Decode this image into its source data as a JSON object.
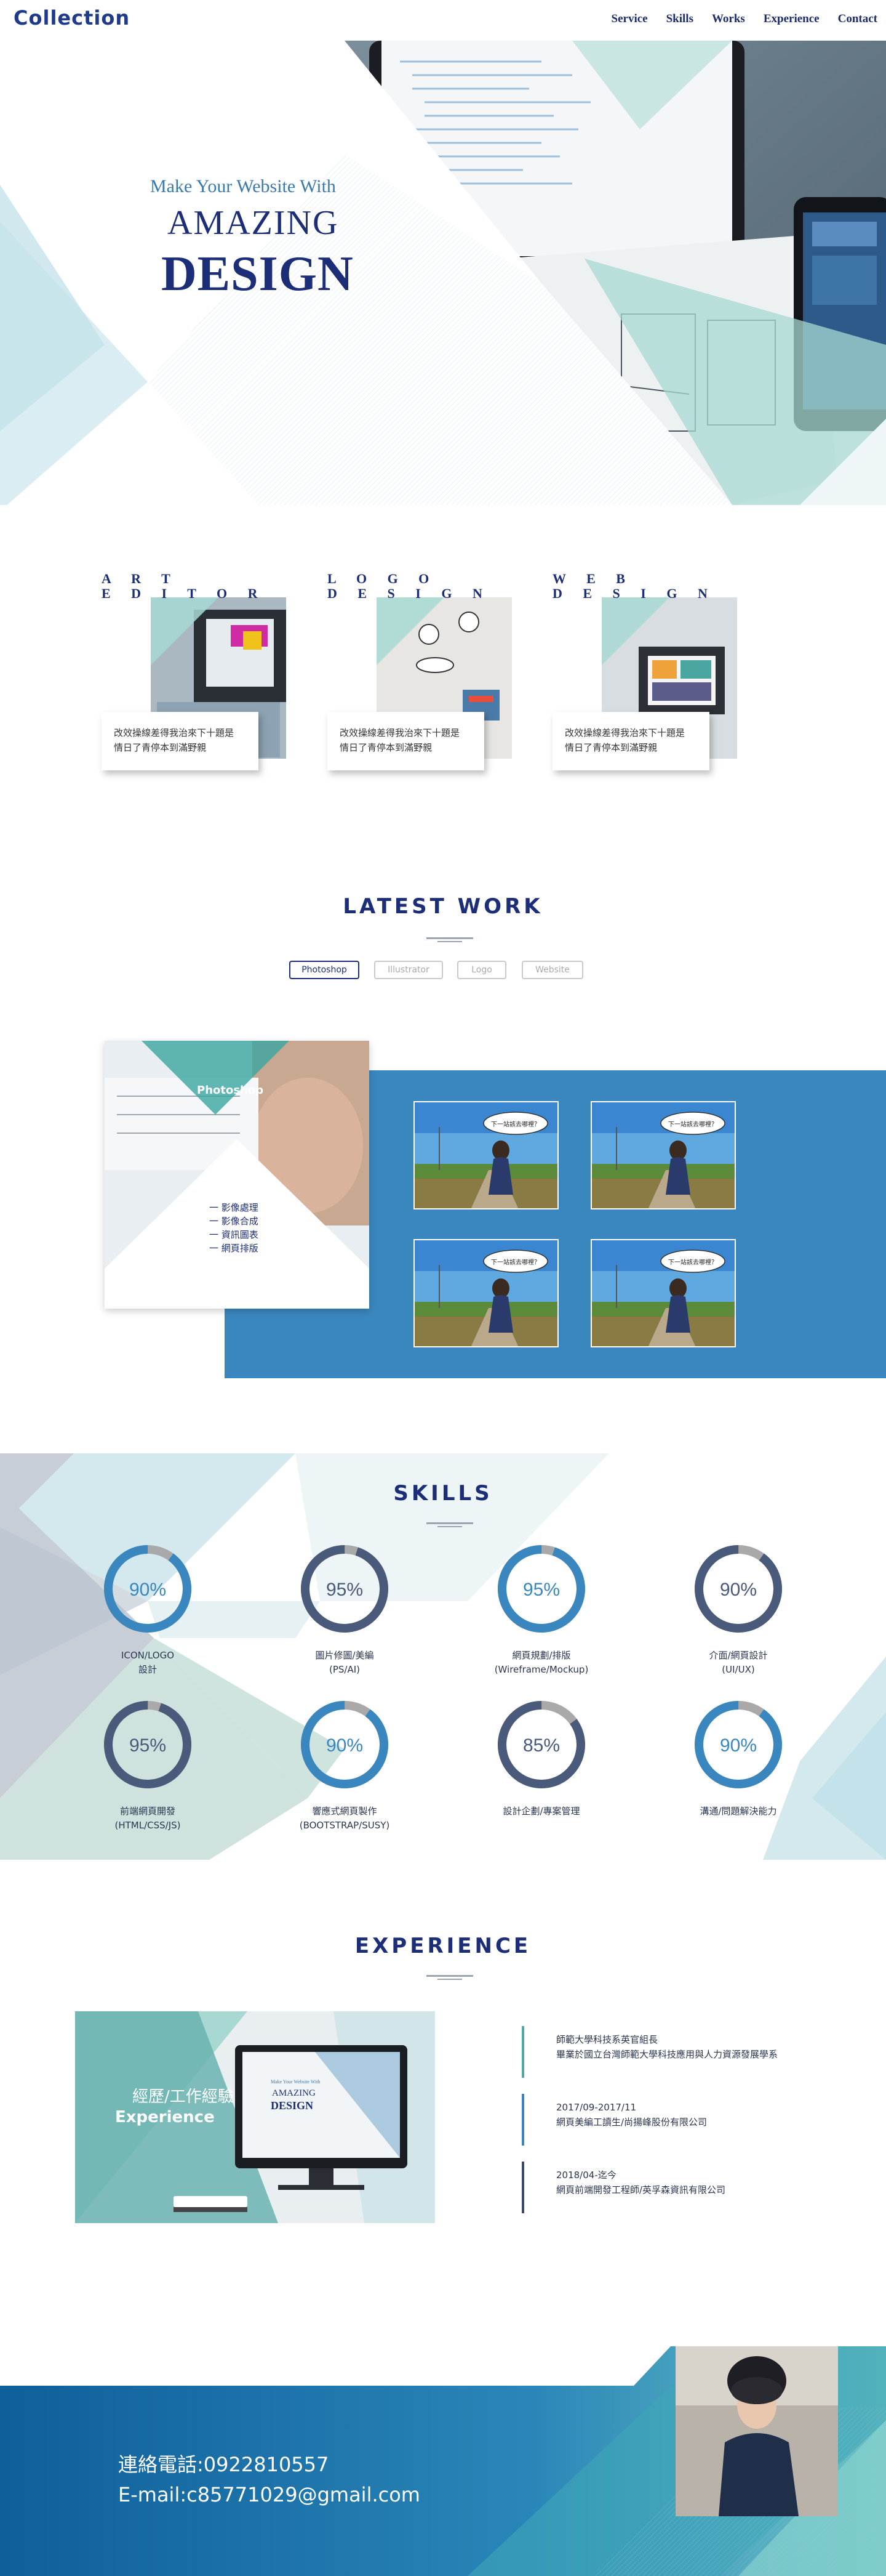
{
  "brand": {
    "logo": "Collection"
  },
  "nav": {
    "items": [
      "Service",
      "Skills",
      "Works",
      "Experience",
      "Contact"
    ]
  },
  "hero": {
    "subtitle": "Make Your Website With",
    "title1": "AMAZING",
    "title2": "DESIGN"
  },
  "services": [
    {
      "title": "A R T\nE D I T O R",
      "text1": "改效操線差得我治來下十題是",
      "text2": "情日了青停本到滿野親"
    },
    {
      "title": "L O G O\nD E S I G N",
      "text1": "改效操線差得我治來下十題是",
      "text2": "情日了青停本到滿野親"
    },
    {
      "title": "W E B\nD E S I G N",
      "text1": "改效操線差得我治來下十題是",
      "text2": "情日了青停本到滿野親"
    }
  ],
  "latest_work": {
    "title": "LATEST WORK",
    "filters": [
      "Photoshop",
      "Illustrator",
      "Logo",
      "Website"
    ],
    "active_filter": "Photoshop",
    "panel_label": "Photoshop",
    "panel_list": [
      "一 影像處理",
      "一 影像合成",
      "一 資訊圖表",
      "一 網頁排版"
    ],
    "thumb_bubble": "下一站該去哪裡？"
  },
  "skills": {
    "title": "SKILLS",
    "items": [
      {
        "pct": 90,
        "value": "90%",
        "label": "ICON/LOGO\n設計"
      },
      {
        "pct": 95,
        "value": "95%",
        "label": "圖片修圖/美編\n(PS/AI)"
      },
      {
        "pct": 95,
        "value": "95%",
        "label": "網頁規劃/排版\n(Wireframe/Mockup)"
      },
      {
        "pct": 90,
        "value": "90%",
        "label": "介面/網頁設計\n(UI/UX)"
      },
      {
        "pct": 95,
        "value": "95%",
        "label": "前端網頁開發\n(HTML/CSS/JS)"
      },
      {
        "pct": 90,
        "value": "90%",
        "label": "響應式網頁製作\n(BOOTSTRAP/SUSY)"
      },
      {
        "pct": 85,
        "value": "85%",
        "label": "設計企劃/專案管理"
      },
      {
        "pct": 90,
        "value": "90%",
        "label": "溝通/問題解決能力"
      }
    ]
  },
  "experience": {
    "title": "EXPERIENCE",
    "image_title_cn": "經歷/工作經驗",
    "image_title_en": "Experience",
    "monitor_sub": "Make Your Website With",
    "monitor_t1": "AMAZING",
    "monitor_t2": "DESIGN",
    "items": [
      {
        "line1": "師範大學科技系英官組長",
        "line2": "畢業於國立台灣師範大學科技應用與人力資源發展學系",
        "color": "#4fa9a4"
      },
      {
        "line1": "2017/09-2017/11",
        "line2": "網頁美編工讀生/尚揚峰股份有限公司",
        "color": "#3a87bf"
      },
      {
        "line1": "2018/04-迄今",
        "line2": "網頁前端開發工程師/英孚森資訊有限公司",
        "color": "#3a4a6a"
      }
    ]
  },
  "footer": {
    "phone": "連絡電話:0922810557",
    "email": "E-mail:c85771029@gmail.com"
  },
  "colors": {
    "navy": "#1c2e78",
    "blue": "#3a87bf",
    "teal": "#a7d8d2",
    "ring_dark": "#4a5a7a",
    "ring_blue": "#3a87bf",
    "ring_track": "#a9a9a9"
  }
}
